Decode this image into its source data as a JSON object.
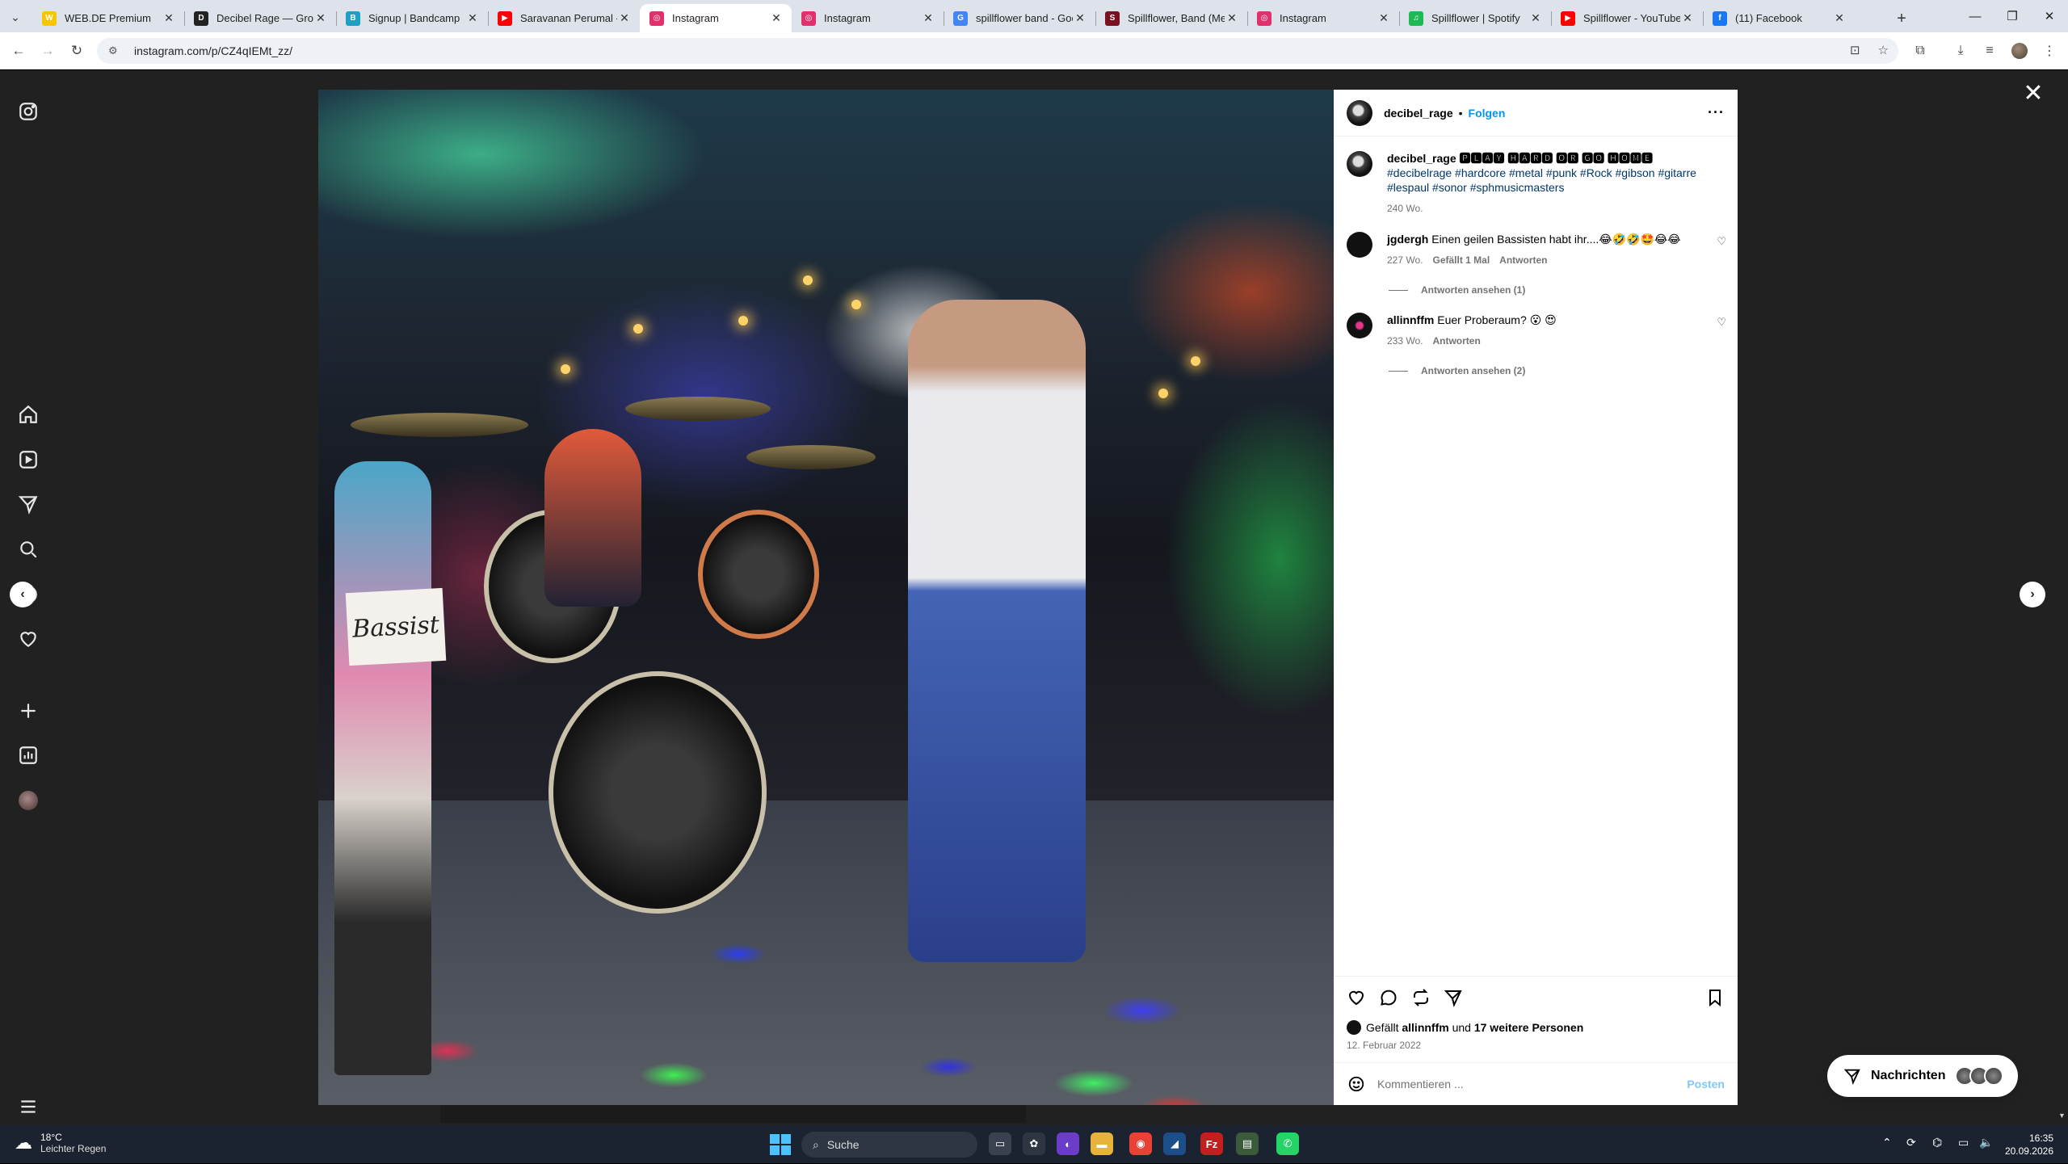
{
  "tabs": [
    {
      "title": "WEB.DE Premium",
      "favicon_color": "#f7c600",
      "favicon": "W"
    },
    {
      "title": "Decibel Rage — Groo",
      "favicon_color": "#222222",
      "favicon": "D"
    },
    {
      "title": "Signup | Bandcamp",
      "favicon_color": "#1da0c3",
      "favicon": "B"
    },
    {
      "title": "Saravanan Perumal - Y",
      "favicon_color": "#ff0000",
      "favicon": "▶"
    },
    {
      "title": "Instagram",
      "favicon_color": "#e1306c",
      "favicon": "◎",
      "active": true
    },
    {
      "title": "Instagram",
      "favicon_color": "#e1306c",
      "favicon": "◎"
    },
    {
      "title": "spillflower band - Goo",
      "favicon_color": "#4285f4",
      "favicon": "G"
    },
    {
      "title": "Spillflower, Band (Met",
      "favicon_color": "#7a1020",
      "favicon": "S"
    },
    {
      "title": "Instagram",
      "favicon_color": "#e1306c",
      "favicon": "◎"
    },
    {
      "title": "Spillflower | Spotify",
      "favicon_color": "#1db954",
      "favicon": "♫"
    },
    {
      "title": "Spillflower - YouTube",
      "favicon_color": "#ff0000",
      "favicon": "▶"
    },
    {
      "title": "(11) Facebook",
      "favicon_color": "#1877f2",
      "favicon": "f"
    }
  ],
  "toolbar": {
    "url": "instagram.com/p/CZ4qIEMt_zz/"
  },
  "post": {
    "image_sign_text": "Bassist",
    "author": "decibel_rage",
    "follow_label": "Folgen",
    "caption_user": "decibel_rage",
    "caption_title": "🅿🅻🅰🆈 🅷🅰🆁🅳 🅾🆁 🅶🅾 🅷🅾🅼🅴",
    "hashtags": "#decibelrage #hardcore #metal #punk #Rock #gibson #gitarre #lespaul #sonor #sphmusicmasters",
    "caption_age": "240 Wo.",
    "comments": [
      {
        "user": "jgdergh",
        "text": "Einen geilen Bassisten habt ihr....😂🤣🤣🤩😂😂",
        "age": "227 Wo.",
        "likes": "Gefällt 1 Mal",
        "reply": "Antworten",
        "view_replies": "Antworten ansehen (1)"
      },
      {
        "user": "allinnffm",
        "text": "Euer Proberaum? 😮 😍",
        "age": "233 Wo.",
        "likes": "",
        "reply": "Antworten",
        "view_replies": "Antworten ansehen (2)"
      }
    ],
    "liked_by_prefix": "Gefällt",
    "liked_by_user": "allinnffm",
    "liked_by_and": "und",
    "liked_by_others": "17 weitere Personen",
    "date": "12. Februar 2022",
    "comment_placeholder": "Kommentieren ...",
    "post_button": "Posten"
  },
  "messages": {
    "label": "Nachrichten"
  },
  "taskbar": {
    "temperature": "18°C",
    "weather_text": "Leichter Regen",
    "search_label": "Suche",
    "time": "16:35",
    "date": "20.09.2026"
  },
  "colors": {
    "accent_blue": "#0095f6",
    "hashtag": "#00376b",
    "muted": "#737373"
  }
}
